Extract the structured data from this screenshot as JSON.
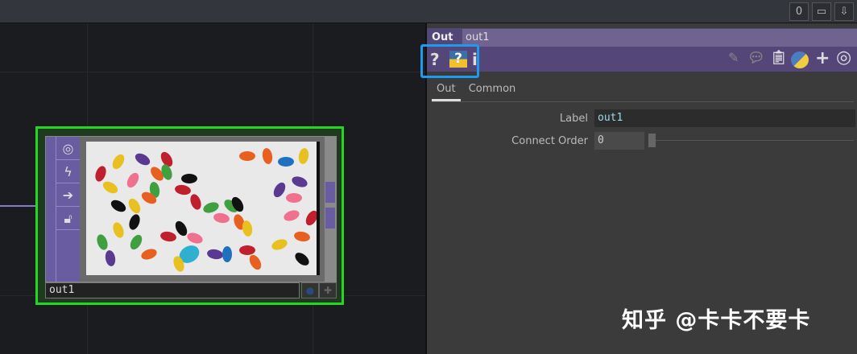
{
  "topbar": {
    "buttons": [
      {
        "icon": "zero-icon",
        "label": "0"
      },
      {
        "icon": "window-icon",
        "label": "▭"
      },
      {
        "icon": "download-arrow-icon",
        "label": "⇩"
      }
    ]
  },
  "node": {
    "name": "out1",
    "side_icons": [
      "viewer-icon",
      "bypass-icon",
      "arrow-right-icon",
      "lock-icon"
    ]
  },
  "panel": {
    "type_label": "Out",
    "name": "out1",
    "icons_left": [
      "help-icon",
      "python-help-icon",
      "info-icon"
    ],
    "icons_right": [
      "edit-icon",
      "comment-icon",
      "clipboard-icon",
      "python-icon",
      "plus-icon",
      "target-icon"
    ],
    "tabs": [
      {
        "label": "Out",
        "active": true
      },
      {
        "label": "Common",
        "active": false
      }
    ],
    "params": [
      {
        "label": "Label",
        "value": "out1"
      },
      {
        "label": "Connect Order",
        "value": "0"
      }
    ]
  },
  "watermark": "知乎 @卡卡不要卡"
}
